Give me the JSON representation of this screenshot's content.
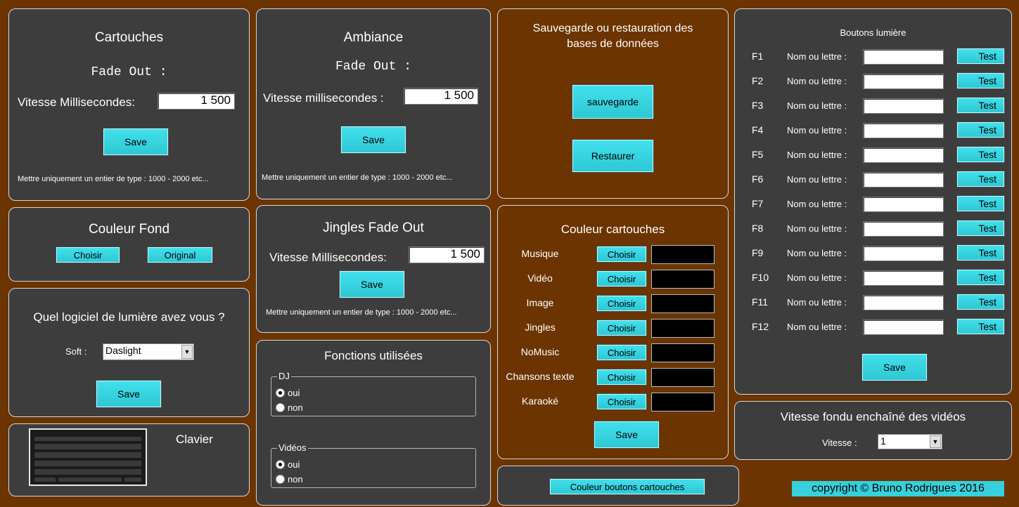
{
  "cartouches": {
    "title": "Cartouches",
    "fade_out": "Fade Out :",
    "speed_label": "Vitesse Millisecondes:",
    "speed_value": "1 500",
    "save": "Save",
    "hint": "Mettre uniquement un entier de type : 1000 - 2000 etc..."
  },
  "ambiance": {
    "title": "Ambiance",
    "fade_out": "Fade Out :",
    "speed_label": "Vitesse millisecondes :",
    "speed_value": "1 500",
    "save": "Save",
    "hint": "Mettre uniquement un entier de type : 1000 - 2000 etc..."
  },
  "backup": {
    "title_line1": "Sauvegarde ou restauration des",
    "title_line2": "bases de données",
    "save_btn": "sauvegarde",
    "restore_btn": "Restaurer"
  },
  "couleur_fond": {
    "title": "Couleur Fond",
    "choose": "Choisir",
    "original": "Original"
  },
  "jingles": {
    "title": "Jingles Fade Out",
    "speed_label": "Vitesse Millisecondes:",
    "speed_value": "1 500",
    "save": "Save",
    "hint": "Mettre uniquement un entier de type : 1000 - 2000 etc..."
  },
  "logiciel": {
    "title": "Quel logiciel de lumière avez vous ?",
    "soft_label": "Soft :",
    "soft_value": "Daslight",
    "save": "Save"
  },
  "clavier": {
    "title": "Clavier"
  },
  "fonctions": {
    "title": "Fonctions utilisées",
    "dj_legend": "DJ",
    "videos_legend": "Vidéos",
    "oui": "oui",
    "non": "non"
  },
  "couleur_cartouches": {
    "title": "Couleur cartouches",
    "choose": "Choisir",
    "save": "Save",
    "rows": [
      "Musique",
      "Vidéo",
      "Image",
      "Jingles",
      "NoMusic",
      "Chansons texte",
      "Karaoké"
    ],
    "swatch_color": "#000000"
  },
  "couleur_boutons": {
    "label": "Couleur boutons cartouches"
  },
  "boutons_lumiere": {
    "title": "Boutons lumière",
    "name_label": "Nom ou lettre :",
    "test": "Test",
    "save": "Save",
    "keys": [
      "F1",
      "F2",
      "F3",
      "F4",
      "F5",
      "F6",
      "F7",
      "F8",
      "F9",
      "F10",
      "F11",
      "F12"
    ]
  },
  "fondu": {
    "title": "Vitesse fondu enchaîné des vidéos",
    "label": "Vitesse :",
    "value": "1"
  },
  "copyright": "copyright © Bruno Rodrigues 2016",
  "colors": {
    "background": "#6b3400",
    "panel": "#3d3d3d",
    "button": "#36d2de"
  }
}
